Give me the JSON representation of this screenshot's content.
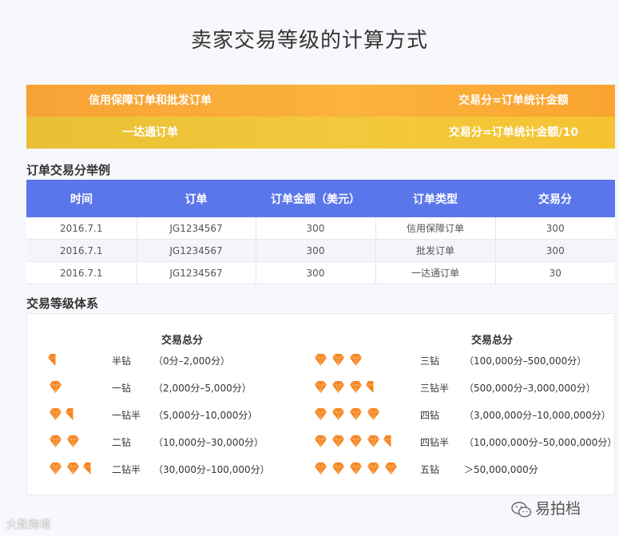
{
  "title": "卖家交易等级的计算方式",
  "bands": [
    {
      "left": "信用保障订单和批发订单",
      "right": "交易分=订单统计金额",
      "color": "#fbab36"
    },
    {
      "left": "一达通订单",
      "right": "交易分=订单统计金额/10",
      "color": "#eec33a"
    }
  ],
  "section1": "订单交易分举例",
  "table": {
    "headers": [
      "时间",
      "订单",
      "订单金额（美元）",
      "订单类型",
      "交易分"
    ],
    "rows": [
      [
        "2016.7.1",
        "JG1234567",
        "300",
        "信用保障订单",
        "300"
      ],
      [
        "2016.7.1",
        "JG1234567",
        "300",
        "批发订单",
        "300"
      ],
      [
        "2016.7.1",
        "JG1234567",
        "300",
        "一达通订单",
        "30"
      ]
    ],
    "header_color": "#5b76ea"
  },
  "section2": "交易等级体系",
  "levels": {
    "left_header": "交易总分",
    "right_header": "交易总分",
    "gem_color": "#f5841f",
    "left": [
      {
        "diamonds": 0.5,
        "name": "半钻",
        "range": "（0分–2,000分）"
      },
      {
        "diamonds": 1,
        "name": "一钻",
        "range": "（2,000分–5,000分）"
      },
      {
        "diamonds": 1.5,
        "name": "一钻半",
        "range": "（5,000分–10,000分）"
      },
      {
        "diamonds": 2,
        "name": "二钻",
        "range": "（10,000分–30,000分）"
      },
      {
        "diamonds": 2.5,
        "name": "二钻半",
        "range": "（30,000分–100,000分）"
      }
    ],
    "right": [
      {
        "diamonds": 3,
        "name": "三钻",
        "range": "（100,000分–500,000分）"
      },
      {
        "diamonds": 3.5,
        "name": "三钻半",
        "range": "（500,000分–3,000,000分）"
      },
      {
        "diamonds": 4,
        "name": "四钻",
        "range": "（3,000,000分–10,000,000分）"
      },
      {
        "diamonds": 4.5,
        "name": "四钻半",
        "range": "（10,000,000分–50,000,000分）"
      },
      {
        "diamonds": 5,
        "name": "五钻",
        "range": "＞50,000,000分"
      }
    ]
  },
  "watermark_left": "大数跨境",
  "watermark_right": "易拍档"
}
